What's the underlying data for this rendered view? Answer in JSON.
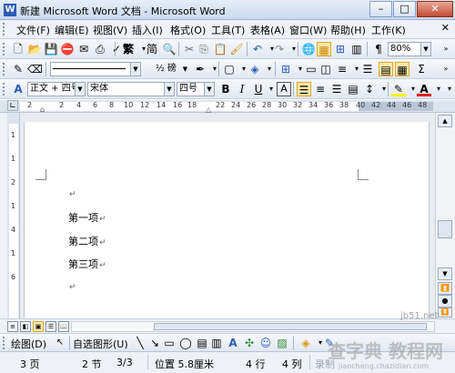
{
  "window": {
    "title": "新建 Microsoft Word 文档 - Microsoft Word",
    "app_icon_letter": "W",
    "minimize": "–",
    "maximize": "□",
    "close": "✕"
  },
  "menu": {
    "items": [
      "文件(F)",
      "编辑(E)",
      "视图(V)",
      "插入(I)",
      "格式(O)",
      "工具(T)",
      "表格(A)",
      "窗口(W)",
      "帮助(H)",
      "工作(K)"
    ],
    "close_doc": "✕"
  },
  "standard_toolbar": {
    "zoom": "80%",
    "icons": [
      "new-doc",
      "open",
      "save",
      "permission",
      "email",
      "print",
      "print-preview",
      "spelling",
      "research",
      "cut",
      "copy",
      "paste",
      "format-painter",
      "undo",
      "redo",
      "hyperlink",
      "tables-borders",
      "insert-table",
      "columns",
      "show-hide",
      "read",
      "help"
    ]
  },
  "drawing_toolbar_top": {
    "line_style": "",
    "weight": "½ 磅"
  },
  "format_toolbar": {
    "style": "正文 + 四号",
    "font": "宋体",
    "size": "四号",
    "bold": "B",
    "italic": "I",
    "underline": "U",
    "char_border": "A",
    "accent_color": "#e0a42a"
  },
  "ruler": {
    "numbers": [
      "2",
      "2",
      "4",
      "6",
      "8",
      "10",
      "12",
      "14",
      "16",
      "18",
      "22",
      "24",
      "26",
      "28",
      "30",
      "32",
      "34",
      "36",
      "38",
      "40",
      "42",
      "44",
      "46",
      "48"
    ],
    "vertical": [
      "1",
      "1",
      "2",
      "1",
      "4",
      "1",
      "6"
    ]
  },
  "document": {
    "lines": [
      "",
      "第一项",
      "第二项",
      "第三项",
      ""
    ],
    "paragraph_mark": "↵"
  },
  "drawing_toolbar": {
    "draw": "绘图(D)",
    "autoshapes": "自选图形(U)"
  },
  "status": {
    "page": "3 页",
    "section": "2 节",
    "page_of": "3/3",
    "position": "位置 5.8厘米",
    "line": "4 行",
    "column": "4 列",
    "rec": "录制"
  },
  "watermark": {
    "site": "jb51.net",
    "brand": "查字典 教程网",
    "url": "jiaocheng.chazidian.com"
  }
}
